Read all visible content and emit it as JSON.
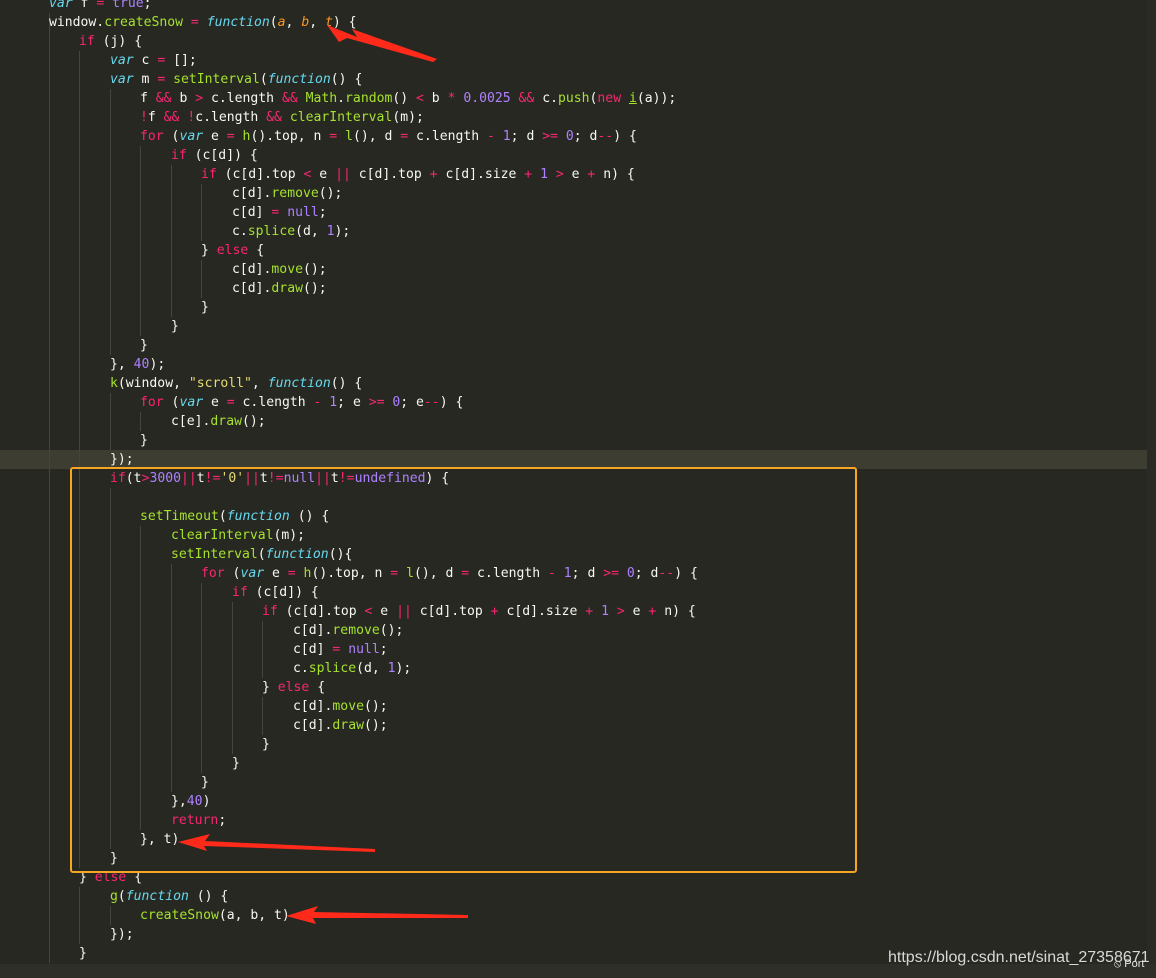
{
  "colors": {
    "background": "#272822",
    "keyword": "#f92672",
    "string": "#e6db74",
    "number": "#ae81ff",
    "function": "#66d9ef",
    "call": "#a6e22e",
    "param": "#fd971f",
    "highlight_box": "#f5a623",
    "annotation_arrow": "#ff2a1a"
  },
  "code_lines": [
    [
      [
        "var ",
        "st"
      ],
      [
        "f ",
        "w"
      ],
      [
        "= ",
        "k"
      ],
      [
        "true",
        "n"
      ],
      [
        ";",
        "w"
      ]
    ],
    [
      [
        "window.",
        "w"
      ],
      [
        "createSnow ",
        "c"
      ],
      [
        "= ",
        "k"
      ],
      [
        "function",
        "st"
      ],
      [
        "(",
        "w"
      ],
      [
        "a",
        "p"
      ],
      [
        ", ",
        "w"
      ],
      [
        "b",
        "p"
      ],
      [
        ", ",
        "w"
      ],
      [
        "t",
        "p"
      ],
      [
        ") {",
        "w"
      ]
    ],
    [
      [
        "if ",
        "k"
      ],
      [
        "(j) {",
        "w"
      ]
    ],
    [
      [
        "var ",
        "st"
      ],
      [
        "c ",
        "w"
      ],
      [
        "= ",
        "k"
      ],
      [
        "[];",
        "w"
      ]
    ],
    [
      [
        "var ",
        "st"
      ],
      [
        "m ",
        "w"
      ],
      [
        "= ",
        "k"
      ],
      [
        "setInterval",
        "c"
      ],
      [
        "(",
        "w"
      ],
      [
        "function",
        "st"
      ],
      [
        "() {",
        "w"
      ]
    ],
    [
      [
        "f ",
        "w"
      ],
      [
        "&& ",
        "k"
      ],
      [
        "b ",
        "w"
      ],
      [
        "> ",
        "k"
      ],
      [
        "c.length ",
        "w"
      ],
      [
        "&& ",
        "k"
      ],
      [
        "Math",
        "c"
      ],
      [
        ".",
        "w"
      ],
      [
        "random",
        "c"
      ],
      [
        "() ",
        "w"
      ],
      [
        "< ",
        "k"
      ],
      [
        "b ",
        "w"
      ],
      [
        "* ",
        "k"
      ],
      [
        "0.0025 ",
        "n"
      ],
      [
        "&& ",
        "k"
      ],
      [
        "c.",
        "w"
      ],
      [
        "push",
        "c"
      ],
      [
        "(",
        "w"
      ],
      [
        "new ",
        "k"
      ],
      [
        "i",
        "c"
      ],
      [
        "(a));",
        "w"
      ]
    ],
    [
      [
        "!",
        "k"
      ],
      [
        "f ",
        "w"
      ],
      [
        "&& ",
        "k"
      ],
      [
        "!",
        "k"
      ],
      [
        "c.length ",
        "w"
      ],
      [
        "&& ",
        "k"
      ],
      [
        "clearInterval",
        "c"
      ],
      [
        "(m);",
        "w"
      ]
    ],
    [
      [
        "for ",
        "k"
      ],
      [
        "(",
        "w"
      ],
      [
        "var ",
        "st"
      ],
      [
        "e ",
        "w"
      ],
      [
        "= ",
        "k"
      ],
      [
        "h",
        "c"
      ],
      [
        "().top, n ",
        "w"
      ],
      [
        "= ",
        "k"
      ],
      [
        "l",
        "c"
      ],
      [
        "(), d ",
        "w"
      ],
      [
        "= ",
        "k"
      ],
      [
        "c.length ",
        "w"
      ],
      [
        "- ",
        "k"
      ],
      [
        "1",
        "n"
      ],
      [
        "; d ",
        "w"
      ],
      [
        ">= ",
        "k"
      ],
      [
        "0",
        "n"
      ],
      [
        "; d",
        "w"
      ],
      [
        "--",
        "k"
      ],
      [
        ") {",
        "w"
      ]
    ],
    [
      [
        "if ",
        "k"
      ],
      [
        "(c[d]) {",
        "w"
      ]
    ],
    [
      [
        "if ",
        "k"
      ],
      [
        "(c[d].top ",
        "w"
      ],
      [
        "< ",
        "k"
      ],
      [
        "e ",
        "w"
      ],
      [
        "|| ",
        "k"
      ],
      [
        "c[d].top ",
        "w"
      ],
      [
        "+ ",
        "k"
      ],
      [
        "c[d].size ",
        "w"
      ],
      [
        "+ ",
        "k"
      ],
      [
        "1 ",
        "n"
      ],
      [
        "> ",
        "k"
      ],
      [
        "e ",
        "w"
      ],
      [
        "+ ",
        "k"
      ],
      [
        "n) {",
        "w"
      ]
    ],
    [
      [
        "c[d].",
        "w"
      ],
      [
        "remove",
        "c"
      ],
      [
        "();",
        "w"
      ]
    ],
    [
      [
        "c[d] ",
        "w"
      ],
      [
        "= ",
        "k"
      ],
      [
        "null",
        "n"
      ],
      [
        ";",
        "w"
      ]
    ],
    [
      [
        "c.",
        "w"
      ],
      [
        "splice",
        "c"
      ],
      [
        "(d, ",
        "w"
      ],
      [
        "1",
        "n"
      ],
      [
        ");",
        "w"
      ]
    ],
    [
      [
        "} ",
        "w"
      ],
      [
        "else ",
        "k"
      ],
      [
        "{",
        "w"
      ]
    ],
    [
      [
        "c[d].",
        "w"
      ],
      [
        "move",
        "c"
      ],
      [
        "();",
        "w"
      ]
    ],
    [
      [
        "c[d].",
        "w"
      ],
      [
        "draw",
        "c"
      ],
      [
        "();",
        "w"
      ]
    ],
    [
      [
        "}",
        "w"
      ]
    ],
    [
      [
        "}",
        "w"
      ]
    ],
    [
      [
        "}",
        "w"
      ]
    ],
    [
      [
        "}, ",
        "w"
      ],
      [
        "40",
        "n"
      ],
      [
        ");",
        "w"
      ]
    ],
    [
      [
        "k",
        "c"
      ],
      [
        "(window, ",
        "w"
      ],
      [
        "\"scroll\"",
        "s"
      ],
      [
        ", ",
        "w"
      ],
      [
        "function",
        "st"
      ],
      [
        "() {",
        "w"
      ]
    ],
    [
      [
        "for ",
        "k"
      ],
      [
        "(",
        "w"
      ],
      [
        "var ",
        "st"
      ],
      [
        "e ",
        "w"
      ],
      [
        "= ",
        "k"
      ],
      [
        "c.length ",
        "w"
      ],
      [
        "- ",
        "k"
      ],
      [
        "1",
        "n"
      ],
      [
        "; e ",
        "w"
      ],
      [
        ">= ",
        "k"
      ],
      [
        "0",
        "n"
      ],
      [
        "; e",
        "w"
      ],
      [
        "--",
        "k"
      ],
      [
        ") {",
        "w"
      ]
    ],
    [
      [
        "c[e].",
        "w"
      ],
      [
        "draw",
        "c"
      ],
      [
        "();",
        "w"
      ]
    ],
    [
      [
        "}",
        "w"
      ]
    ],
    [
      [
        "});",
        "w"
      ]
    ],
    [
      [
        "if",
        "k"
      ],
      [
        "(t",
        "w"
      ],
      [
        ">",
        "k"
      ],
      [
        "3000",
        "n"
      ],
      [
        "||",
        "k"
      ],
      [
        "t",
        "w"
      ],
      [
        "!=",
        "k"
      ],
      [
        "'0'",
        "s"
      ],
      [
        "||",
        "k"
      ],
      [
        "t",
        "w"
      ],
      [
        "!=",
        "k"
      ],
      [
        "null",
        "n"
      ],
      [
        "||",
        "k"
      ],
      [
        "t",
        "w"
      ],
      [
        "!=",
        "k"
      ],
      [
        "undefined",
        "n"
      ],
      [
        ") {",
        "w"
      ]
    ],
    [],
    [
      [
        "setTimeout",
        "c"
      ],
      [
        "(",
        "w"
      ],
      [
        "function ",
        "st"
      ],
      [
        "() {",
        "w"
      ]
    ],
    [
      [
        "clearInterval",
        "c"
      ],
      [
        "(m);",
        "w"
      ]
    ],
    [
      [
        "setInterval",
        "c"
      ],
      [
        "(",
        "w"
      ],
      [
        "function",
        "st"
      ],
      [
        "(){",
        "w"
      ]
    ],
    [
      [
        "for ",
        "k"
      ],
      [
        "(",
        "w"
      ],
      [
        "var ",
        "st"
      ],
      [
        "e ",
        "w"
      ],
      [
        "= ",
        "k"
      ],
      [
        "h",
        "c"
      ],
      [
        "().top, n ",
        "w"
      ],
      [
        "= ",
        "k"
      ],
      [
        "l",
        "c"
      ],
      [
        "(), d ",
        "w"
      ],
      [
        "= ",
        "k"
      ],
      [
        "c.length ",
        "w"
      ],
      [
        "- ",
        "k"
      ],
      [
        "1",
        "n"
      ],
      [
        "; d ",
        "w"
      ],
      [
        ">= ",
        "k"
      ],
      [
        "0",
        "n"
      ],
      [
        "; d",
        "w"
      ],
      [
        "--",
        "k"
      ],
      [
        ") {",
        "w"
      ]
    ],
    [
      [
        "if ",
        "k"
      ],
      [
        "(c[d]) {",
        "w"
      ]
    ],
    [
      [
        "if ",
        "k"
      ],
      [
        "(c[d].top ",
        "w"
      ],
      [
        "< ",
        "k"
      ],
      [
        "e ",
        "w"
      ],
      [
        "|| ",
        "k"
      ],
      [
        "c[d].top ",
        "w"
      ],
      [
        "+ ",
        "k"
      ],
      [
        "c[d].size ",
        "w"
      ],
      [
        "+ ",
        "k"
      ],
      [
        "1 ",
        "n"
      ],
      [
        "> ",
        "k"
      ],
      [
        "e ",
        "w"
      ],
      [
        "+ ",
        "k"
      ],
      [
        "n) {",
        "w"
      ]
    ],
    [
      [
        "c[d].",
        "w"
      ],
      [
        "remove",
        "c"
      ],
      [
        "();",
        "w"
      ]
    ],
    [
      [
        "c[d] ",
        "w"
      ],
      [
        "= ",
        "k"
      ],
      [
        "null",
        "n"
      ],
      [
        ";",
        "w"
      ]
    ],
    [
      [
        "c.",
        "w"
      ],
      [
        "splice",
        "c"
      ],
      [
        "(d, ",
        "w"
      ],
      [
        "1",
        "n"
      ],
      [
        ");",
        "w"
      ]
    ],
    [
      [
        "} ",
        "w"
      ],
      [
        "else ",
        "k"
      ],
      [
        "{",
        "w"
      ]
    ],
    [
      [
        "c[d].",
        "w"
      ],
      [
        "move",
        "c"
      ],
      [
        "();",
        "w"
      ]
    ],
    [
      [
        "c[d].",
        "w"
      ],
      [
        "draw",
        "c"
      ],
      [
        "();",
        "w"
      ]
    ],
    [
      [
        "}",
        "w"
      ]
    ],
    [
      [
        "}",
        "w"
      ]
    ],
    [
      [
        "}",
        "w"
      ]
    ],
    [
      [
        "},",
        "w"
      ],
      [
        "40",
        "n"
      ],
      [
        ")",
        "w"
      ]
    ],
    [
      [
        "return",
        "k"
      ],
      [
        ";",
        "w"
      ]
    ],
    [
      [
        "}, t)",
        "w"
      ]
    ],
    [
      [
        "}",
        "w"
      ]
    ],
    [
      [
        "} ",
        "w"
      ],
      [
        "else ",
        "k"
      ],
      [
        "{",
        "w"
      ]
    ],
    [
      [
        "g",
        "c"
      ],
      [
        "(",
        "w"
      ],
      [
        "function ",
        "st"
      ],
      [
        "() {",
        "w"
      ]
    ],
    [
      [
        "createSnow",
        "c"
      ],
      [
        "(a, b, t)",
        "w"
      ]
    ],
    [
      [
        "});",
        "w"
      ]
    ],
    [
      [
        "}",
        "w"
      ]
    ]
  ],
  "watermark": "https://blog.csdn.net/sinat_27358671",
  "status_port": "Port"
}
